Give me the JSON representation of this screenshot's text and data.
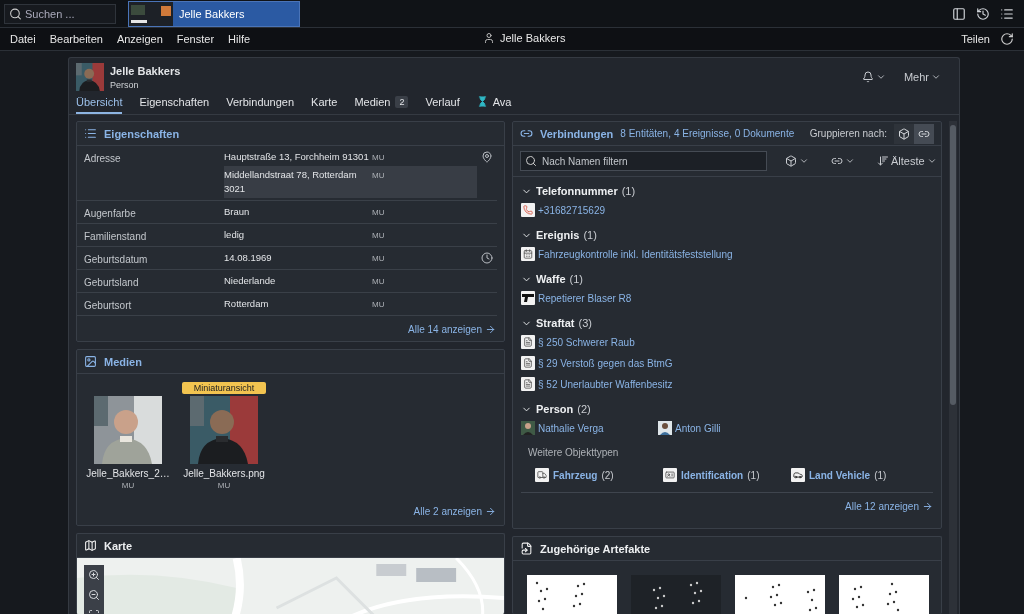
{
  "search": {
    "placeholder": "Suchen ..."
  },
  "open_tab": {
    "title": "Jelle Bakkers",
    "selected": true
  },
  "menu": [
    "Datei",
    "Bearbeiten",
    "Anzeigen",
    "Fenster",
    "Hilfe"
  ],
  "user": "Jelle Bakkers",
  "share": "Teilen",
  "entity": {
    "name": "Jelle Bakkers",
    "type": "Person",
    "more": "Mehr"
  },
  "tabs": [
    {
      "label": "Übersicht",
      "selected": true
    },
    {
      "label": "Eigenschaften",
      "selected": false
    },
    {
      "label": "Verbindungen",
      "selected": false
    },
    {
      "label": "Karte",
      "selected": false
    },
    {
      "label": "Medien",
      "badge": "2",
      "selected": false
    },
    {
      "label": "Verlauf",
      "selected": false
    },
    {
      "label": "Ava",
      "kind": "app",
      "selected": false
    }
  ],
  "properties": {
    "title": "Eigenschaften",
    "more": "Alle 14 anzeigen",
    "rows": [
      {
        "label": "Adresse",
        "kind": "location",
        "values": [
          {
            "text": "Hauptstraße 13, Forchheim 91301",
            "source": "MU",
            "highlighted": false
          },
          {
            "text": "Middellandstraat 78, Rotterdam 3021",
            "source": "MU",
            "highlighted": true
          }
        ]
      },
      {
        "label": "Augenfarbe",
        "kind": "plain",
        "values": [
          {
            "text": "Braun",
            "source": "MU",
            "highlighted": false
          }
        ]
      },
      {
        "label": "Familienstand",
        "kind": "plain",
        "values": [
          {
            "text": "ledig",
            "source": "MU",
            "highlighted": false
          }
        ]
      },
      {
        "label": "Geburtsdatum",
        "kind": "time",
        "values": [
          {
            "text": "14.08.1969",
            "source": "MU",
            "highlighted": false
          }
        ]
      },
      {
        "label": "Geburtsland",
        "kind": "plain",
        "values": [
          {
            "text": "Niederlande",
            "source": "MU",
            "highlighted": false
          }
        ]
      },
      {
        "label": "Geburtsort",
        "kind": "plain",
        "values": [
          {
            "text": "Rotterdam",
            "source": "MU",
            "highlighted": false
          }
        ]
      }
    ]
  },
  "media": {
    "title": "Medien",
    "more": "Alle 2 anzeigen",
    "items": [
      {
        "name": "Jelle_Bakkers_2…",
        "source": "MU",
        "kind": "picture"
      },
      {
        "name": "Jelle_Bakkers.png",
        "source": "MU",
        "badge": "Miniaturansicht",
        "kind": "picture"
      }
    ]
  },
  "map": {
    "title": "Karte",
    "kind": "picture"
  },
  "connections": {
    "title": "Verbindungen",
    "summary": [
      "8 Entitäten,",
      "4 Ereignisse,",
      "0 Dokumente"
    ],
    "group_label": "Gruppieren nach:",
    "group_options": [
      {
        "kind": "object",
        "selected": false
      },
      {
        "kind": "link",
        "selected": true
      }
    ],
    "filter": {
      "placeholder": "Nach Namen filtern"
    },
    "sort": "Älteste",
    "groups": [
      {
        "title": "Telefonnummer",
        "count": "(1)",
        "expanded": true,
        "kind": "list",
        "items": [
          {
            "name": "+31682715629",
            "kind": "phone"
          }
        ]
      },
      {
        "title": "Ereignis",
        "count": "(1)",
        "expanded": true,
        "kind": "list",
        "items": [
          {
            "name": "Fahrzeugkontrolle inkl. Identitätsfeststellung",
            "kind": "event"
          }
        ]
      },
      {
        "title": "Waffe",
        "count": "(1)",
        "expanded": true,
        "kind": "list",
        "items": [
          {
            "name": "Repetierer Blaser R8",
            "kind": "weapon"
          }
        ]
      },
      {
        "title": "Straftat",
        "count": "(3)",
        "expanded": true,
        "kind": "list",
        "items": [
          {
            "name": "§ 250 Schwerer Raub",
            "kind": "offense"
          },
          {
            "name": "§ 29 Verstoß gegen das BtmG",
            "kind": "offense"
          },
          {
            "name": "§ 52 Unerlaubter Waffenbesitz",
            "kind": "offense"
          }
        ]
      },
      {
        "title": "Person",
        "count": "(2)",
        "expanded": true,
        "kind": "columns",
        "items": [
          {
            "name": "Nathalie Verga",
            "kind": "person"
          },
          {
            "name": "Anton Gilli",
            "kind": "person"
          }
        ]
      }
    ],
    "other_types_label": "Weitere Objekttypen",
    "other_types": [
      {
        "name": "Fahrzeug",
        "count": "(2)",
        "kind": "truck"
      },
      {
        "name": "Identification",
        "count": "(1)",
        "kind": "id"
      },
      {
        "name": "Land Vehicle",
        "count": "(1)",
        "kind": "car"
      }
    ],
    "more": "Alle 12 anzeigen"
  },
  "artifacts": {
    "title": "Zugehörige Artefakte"
  }
}
